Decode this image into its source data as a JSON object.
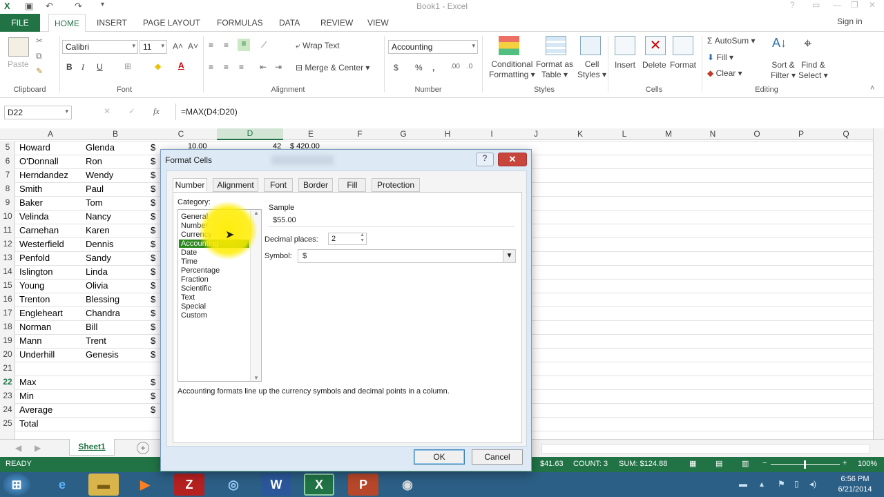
{
  "window": {
    "title": "Book1 - Excel"
  },
  "ribbon_tabs": [
    "FILE",
    "HOME",
    "INSERT",
    "PAGE LAYOUT",
    "FORMULAS",
    "DATA",
    "REVIEW",
    "VIEW"
  ],
  "signin": "Sign in",
  "clipboard": {
    "paste": "Paste",
    "group": "Clipboard"
  },
  "font": {
    "name": "Calibri",
    "size": "11",
    "bold": "B",
    "italic": "I",
    "underline": "U",
    "group": "Font"
  },
  "alignment": {
    "wrap": "Wrap Text",
    "merge": "Merge & Center",
    "group": "Alignment"
  },
  "number": {
    "format": "Accounting",
    "currency": "$",
    "percent": "%",
    "comma": ",",
    "group": "Number"
  },
  "styles": {
    "conditional": [
      "Conditional",
      "Formatting ▾"
    ],
    "format_table": [
      "Format as",
      "Table ▾"
    ],
    "cell_styles": [
      "Cell",
      "Styles ▾"
    ],
    "group": "Styles"
  },
  "cells": {
    "insert": "Insert",
    "delete": "Delete",
    "format": "Format",
    "group": "Cells"
  },
  "editing": {
    "autosum": "AutoSum",
    "fill": "Fill",
    "clear": "Clear",
    "sort": [
      "Sort &",
      "Filter ▾"
    ],
    "find": [
      "Find &",
      "Select ▾"
    ],
    "group": "Editing"
  },
  "formula_bar": {
    "name_box": "D22",
    "formula": "=MAX(D4:D20)",
    "fx": "fx"
  },
  "columns": [
    "A",
    "B",
    "C",
    "D",
    "E",
    "F",
    "G",
    "H",
    "I",
    "J",
    "K",
    "L",
    "M",
    "N",
    "O",
    "P",
    "Q"
  ],
  "rows": [
    {
      "n": "5",
      "a": "Howard",
      "b": "Glenda",
      "c": "$"
    },
    {
      "n": "6",
      "a": "O'Donnall",
      "b": "Ron",
      "c": "$"
    },
    {
      "n": "7",
      "a": "Herndandez",
      "b": "Wendy",
      "c": "$"
    },
    {
      "n": "8",
      "a": "Smith",
      "b": "Paul",
      "c": "$"
    },
    {
      "n": "9",
      "a": "Baker",
      "b": "Tom",
      "c": "$"
    },
    {
      "n": "10",
      "a": "Velinda",
      "b": "Nancy",
      "c": "$"
    },
    {
      "n": "11",
      "a": "Carnehan",
      "b": "Karen",
      "c": "$"
    },
    {
      "n": "12",
      "a": "Westerfield",
      "b": "Dennis",
      "c": "$"
    },
    {
      "n": "13",
      "a": "Penfold",
      "b": "Sandy",
      "c": "$"
    },
    {
      "n": "14",
      "a": "Islington",
      "b": "Linda",
      "c": "$"
    },
    {
      "n": "15",
      "a": "Young",
      "b": "Olivia",
      "c": "$"
    },
    {
      "n": "16",
      "a": "Trenton",
      "b": "Blessing",
      "c": "$"
    },
    {
      "n": "17",
      "a": "Engleheart",
      "b": "Chandra",
      "c": "$"
    },
    {
      "n": "18",
      "a": "Norman",
      "b": "Bill",
      "c": "$"
    },
    {
      "n": "19",
      "a": "Mann",
      "b": "Trent",
      "c": "$"
    },
    {
      "n": "20",
      "a": "Underhill",
      "b": "Genesis",
      "c": "$"
    },
    {
      "n": "21",
      "a": "",
      "b": "",
      "c": ""
    },
    {
      "n": "22",
      "a": "Max",
      "b": "",
      "c": "$"
    },
    {
      "n": "23",
      "a": "Min",
      "b": "",
      "c": "$"
    },
    {
      "n": "24",
      "a": "Average",
      "b": "",
      "c": "$"
    },
    {
      "n": "25",
      "a": "Total",
      "b": "",
      "c": ""
    }
  ],
  "row5_partial": {
    "c": "10.00",
    "d": "42",
    "e": "$ 420.00"
  },
  "sheet_tab": "Sheet1",
  "status": {
    "ready": "READY",
    "average": "$41.63",
    "count": "COUNT: 3",
    "sum": "SUM: $124.88",
    "zoom": "100%"
  },
  "clock": {
    "time": "6:56 PM",
    "date": "6/21/2014"
  },
  "dialog": {
    "title": "Format Cells",
    "help": "?",
    "close": "✕",
    "tabs": [
      "Number",
      "Alignment",
      "Font",
      "Border",
      "Fill",
      "Protection"
    ],
    "category_label": "Category:",
    "categories": [
      "General",
      "Number",
      "Currency",
      "Accounting",
      "Date",
      "Time",
      "Percentage",
      "Fraction",
      "Scientific",
      "Text",
      "Special",
      "Custom"
    ],
    "selected_category": "Accounting",
    "sample_label": "Sample",
    "sample_value": "$55.00",
    "decimal_label": "Decimal places:",
    "decimal_value": "2",
    "symbol_label": "Symbol:",
    "symbol_value": "$",
    "description": "Accounting formats line up the currency symbols and decimal points in a column.",
    "ok": "OK",
    "cancel": "Cancel"
  },
  "colors": {
    "excel_green": "#217346",
    "selection_green": "#2a8a1e",
    "highlight": "#ffec00"
  }
}
